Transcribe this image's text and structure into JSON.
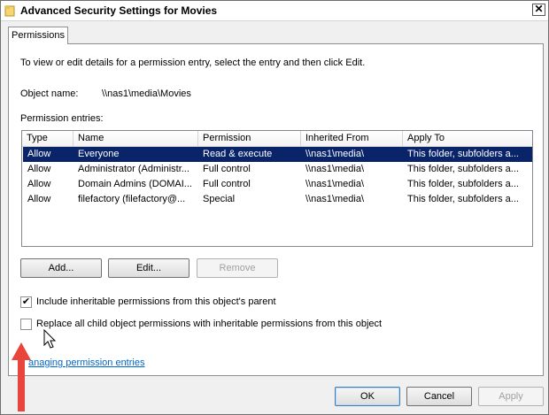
{
  "window": {
    "title": "Advanced Security Settings for Movies",
    "close_glyph": "✕"
  },
  "tabs": [
    {
      "label": "Permissions"
    }
  ],
  "instructions": "To view or edit details for a permission entry, select the entry and then click Edit.",
  "object": {
    "label": "Object name:",
    "value": "\\\\nas1\\media\\Movies"
  },
  "entries_label": "Permission entries:",
  "table": {
    "columns": [
      "Type",
      "Name",
      "Permission",
      "Inherited From",
      "Apply To"
    ],
    "rows": [
      {
        "type": "Allow",
        "name": "Everyone",
        "permission": "Read & execute",
        "inherited_from": "\\\\nas1\\media\\",
        "apply_to": "This folder, subfolders a..."
      },
      {
        "type": "Allow",
        "name": "Administrator (Administr...",
        "permission": "Full control",
        "inherited_from": "\\\\nas1\\media\\",
        "apply_to": "This folder, subfolders a..."
      },
      {
        "type": "Allow",
        "name": "Domain Admins (DOMAI...",
        "permission": "Full control",
        "inherited_from": "\\\\nas1\\media\\",
        "apply_to": "This folder, subfolders a..."
      },
      {
        "type": "Allow",
        "name": "filefactory (filefactory@...",
        "permission": "Special",
        "inherited_from": "\\\\nas1\\media\\",
        "apply_to": "This folder, subfolders a..."
      }
    ],
    "selected_row": 0
  },
  "buttons": {
    "add": "Add...",
    "edit": "Edit...",
    "remove": "Remove",
    "ok": "OK",
    "cancel": "Cancel",
    "apply": "Apply"
  },
  "checkboxes": {
    "include_inheritable": {
      "label": "Include inheritable permissions from this object's parent",
      "checked": true,
      "glyph": "✔"
    },
    "replace_child": {
      "label": "Replace all child object permissions with inheritable permissions from this object",
      "checked": false
    }
  },
  "link": {
    "text": "anaging permission entries"
  },
  "colors": {
    "selection": "#0a246a",
    "link": "#0066cc",
    "arrow": "#e8453c"
  }
}
